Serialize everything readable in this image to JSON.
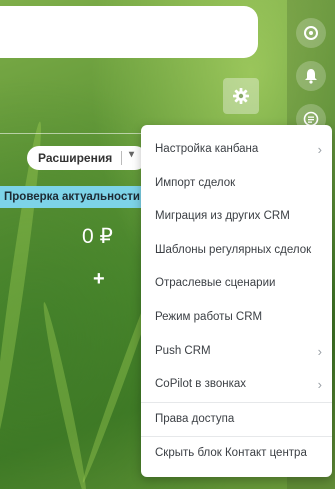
{
  "toolbar": {
    "extensions_label": "Расширения"
  },
  "banner": {
    "text": "Проверка актуальности д"
  },
  "column": {
    "sum": "0 ₽",
    "add_symbol": "+"
  },
  "settings_menu": {
    "items": [
      {
        "label": "Настройка канбана",
        "has_submenu": true
      },
      {
        "label": "Импорт сделок",
        "has_submenu": false
      },
      {
        "label": "Миграция из других CRM",
        "has_submenu": false
      },
      {
        "label": "Шаблоны регулярных сделок",
        "has_submenu": false
      },
      {
        "label": "Отраслевые сценарии",
        "has_submenu": false
      },
      {
        "label": "Режим работы CRM",
        "has_submenu": false
      },
      {
        "label": "Push CRM",
        "has_submenu": true
      },
      {
        "label": "CoPilot в звонках",
        "has_submenu": true
      },
      {
        "label": "Права доступа",
        "has_submenu": false
      },
      {
        "label": "Скрыть блок Контакт центра",
        "has_submenu": false
      }
    ]
  },
  "icons": {
    "rail": [
      "copilot-icon",
      "bell-icon",
      "list-icon"
    ],
    "gear": "gear-icon"
  },
  "colors": {
    "banner_bg": "#7dd3e8",
    "background": "#5f9636"
  }
}
